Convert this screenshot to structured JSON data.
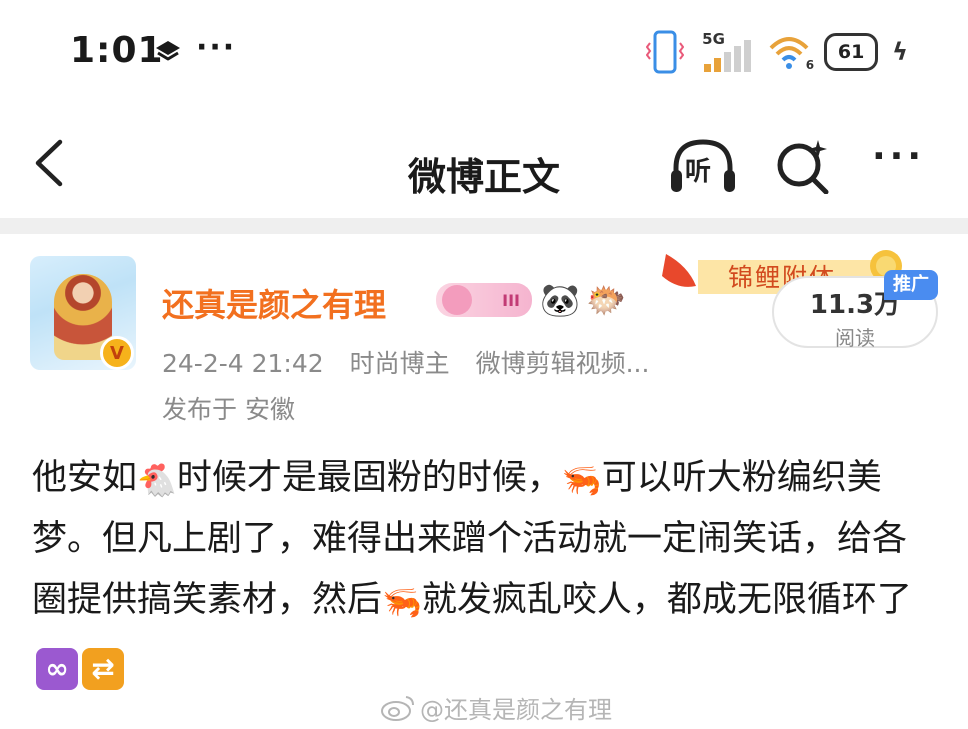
{
  "status_bar": {
    "time": "1:01",
    "dots": "···",
    "network": "5G",
    "wifi_badge": "6",
    "battery": "61",
    "charging_icon": "bolt-icon"
  },
  "nav": {
    "title": "微博正文",
    "listen_label": "听",
    "more": "···"
  },
  "post": {
    "username": "还真是颜之有理",
    "member_badge": "III",
    "emoji_panda": "🐼",
    "emoji_fish": "🐡",
    "date": "24-2-4 21:42",
    "tag1": "时尚博主",
    "tag2": "微博剪辑视频...",
    "location": "发布于 安徽",
    "koi_banner": "锦鲤附体",
    "reads_count": "11.3万",
    "reads_label": "阅读",
    "promo_tag": "推广",
    "content": {
      "seg1": "他安如",
      "emo_chicken": "🐔",
      "seg2": "时候才是最固粉的时候，",
      "emo_shrimp1": "🦐",
      "seg3": "可以听大粉编织美梦。但凡上剧了，难得出来蹭个活动就一定闹笑话，给各圈提供搞笑素材，然后",
      "emo_shrimp2": "🦐",
      "seg4": "就发疯乱咬人，都成无限循环了",
      "emo_infinity": "∞",
      "emo_repeat": "⇄"
    }
  },
  "watermark": "@还真是颜之有理",
  "colors": {
    "username": "#f2701f",
    "meta": "#8a8a8a",
    "promo": "#4a8cf0",
    "divider": "#efefef"
  }
}
